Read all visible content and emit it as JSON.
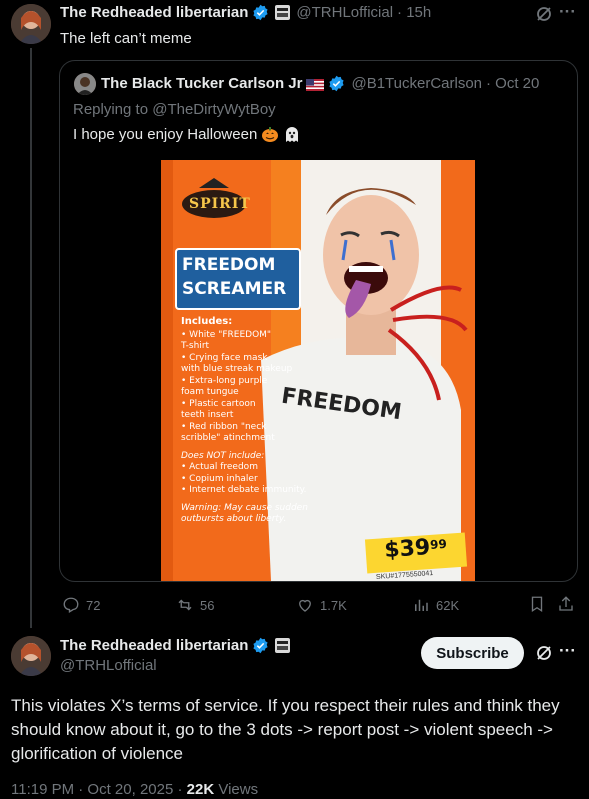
{
  "tweet1": {
    "name": "The Redheaded libertarian",
    "handle": "@TRHLofficial",
    "time": "· 15h",
    "text": "The left can’t meme",
    "more": "···"
  },
  "quote": {
    "name": "The Black Tucker Carlson Jr",
    "flag": "🇺🇸",
    "handle": "@B1TuckerCarlson",
    "time": "· Oct 20",
    "replying_prefix": "Replying to ",
    "replying_to": "@TheDirtyWytBoy",
    "text": "I hope you enjoy Halloween",
    "emoji1": "🎃",
    "emoji2": "👻"
  },
  "product": {
    "brand": "SPIRIT",
    "title_line1": "FREEDOM",
    "title_line2": "SCREAMER",
    "includes_label": "Includes:",
    "includes": [
      "• White \"FREEDOM\"",
      "  T-shirt",
      "• Crying face mask",
      "  with blue streak makeup",
      "• Extra-long purple",
      "  foam tungue",
      "• Plastic cartoon",
      "  teeth insert",
      "• Red ribbon \"neck",
      "  scribble\" atinchment"
    ],
    "not_included_label": "Does NOT include:",
    "not_included": [
      "• Actual freedom",
      "• Copium inhaler",
      "• Internet debate immunity."
    ],
    "warning": "Warning: May cause sudden",
    "warning2": "outbursts about liberty.",
    "shirt_text": "FREEDOM",
    "price_dollars": "$39",
    "price_cents": "99",
    "sku": "SKU#1775550041"
  },
  "actions": {
    "replies": "72",
    "reposts": "56",
    "likes": "1.7K",
    "views": "62K"
  },
  "tweet2": {
    "name": "The Redheaded libertarian",
    "handle": "@TRHLofficial",
    "subscribe": "Subscribe",
    "more": "···",
    "text": "This violates X’s terms of service. If you respect their rules and think they should know about it, go to the 3 dots -> report post -> violent speech -> glorification of violence",
    "time": "11:19 PM · Oct 20, 2025 ·",
    "views_count": "22K",
    "views_label": "Views"
  },
  "colors": {
    "verified": "#1d9bf0",
    "orange": "#f26a1b",
    "blue_title": "#1f5f9e"
  }
}
